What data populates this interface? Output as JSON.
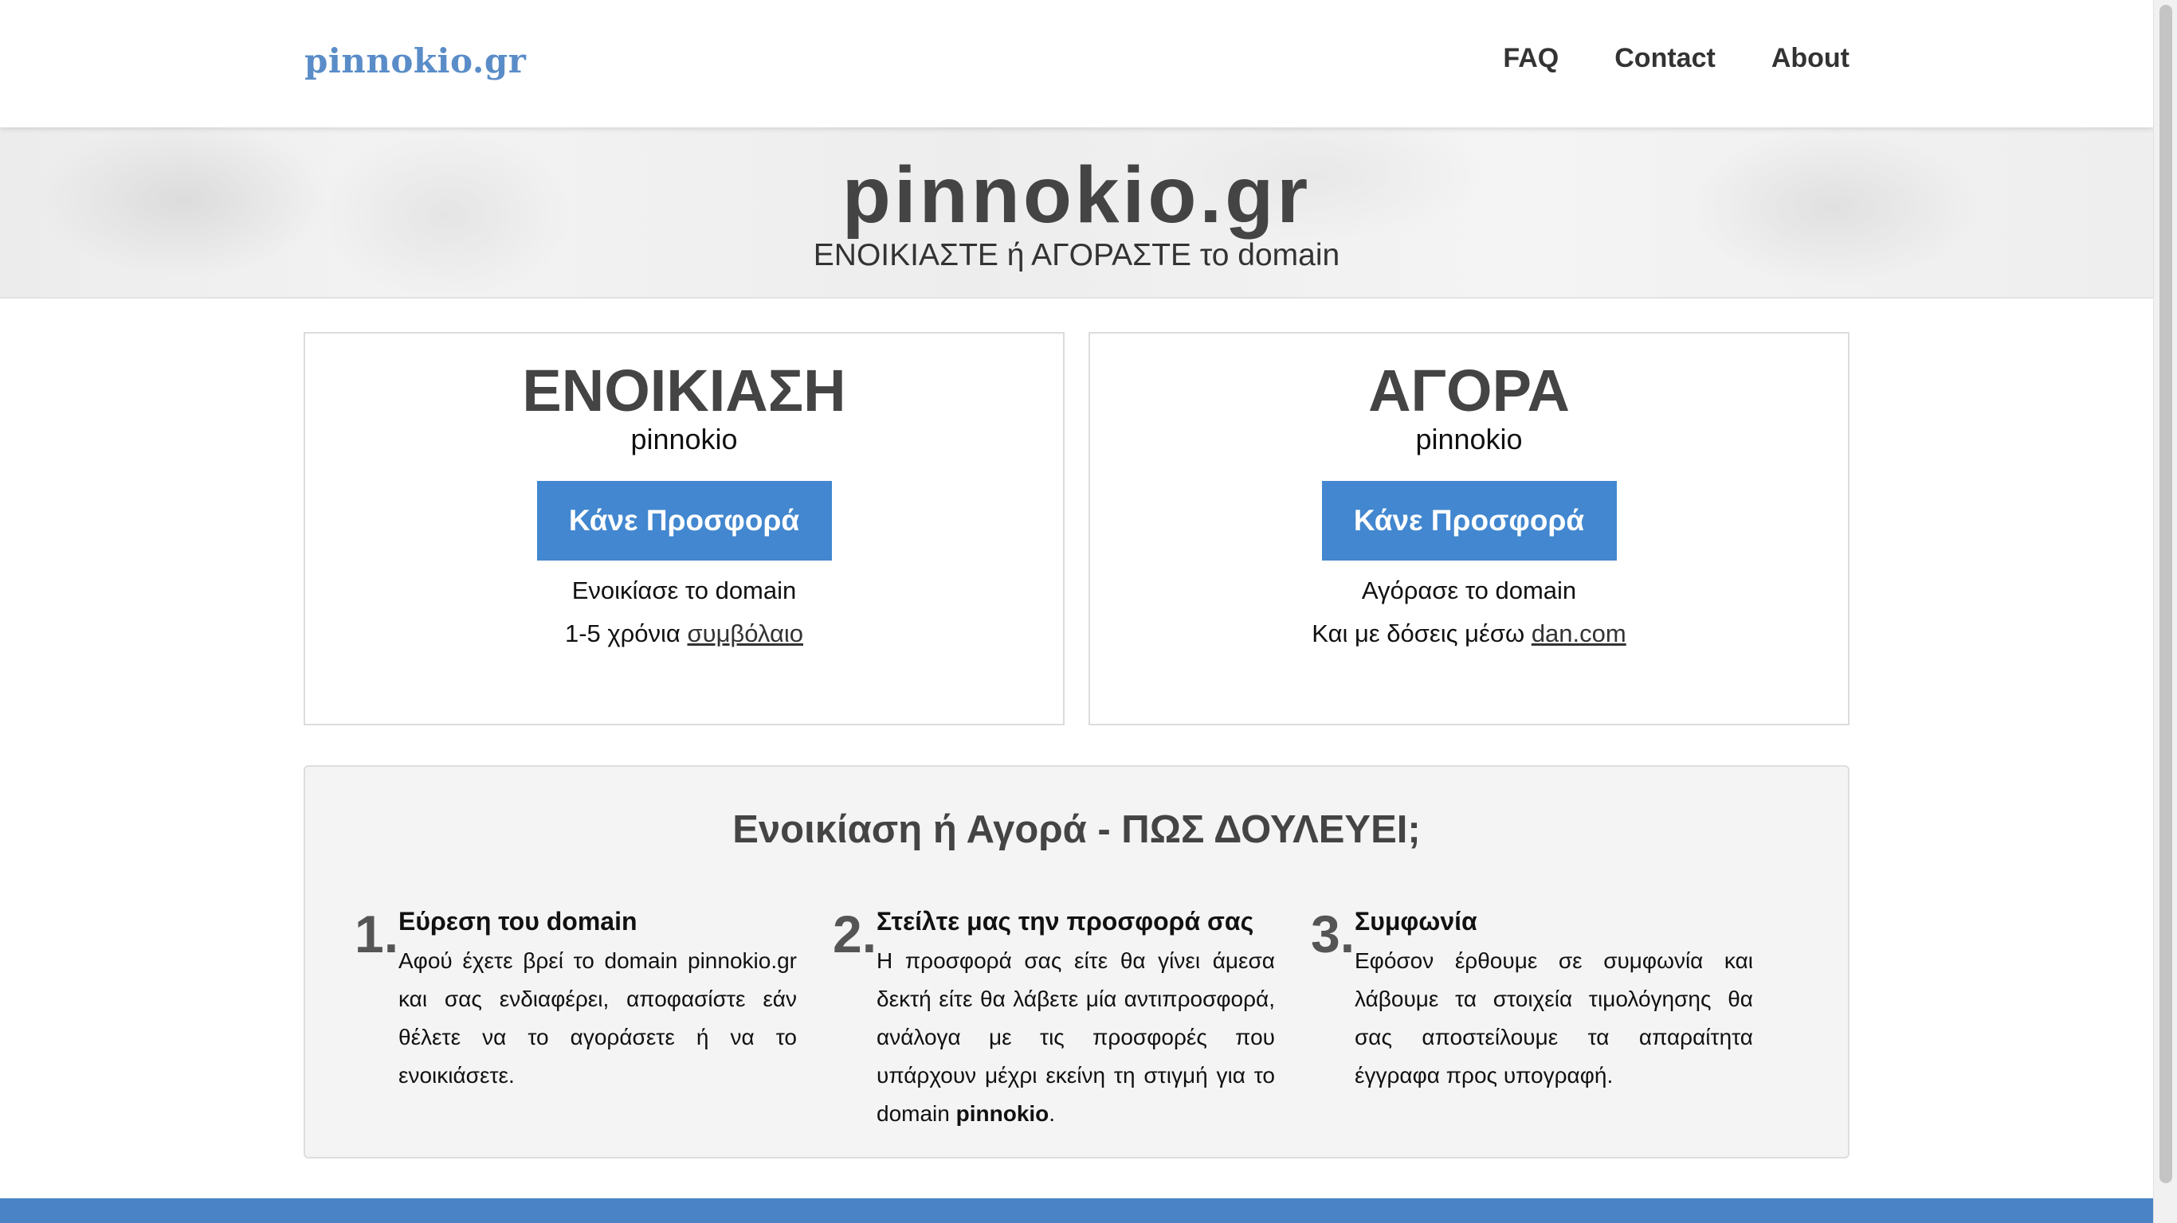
{
  "header": {
    "brand": "pinnokio.gr",
    "nav": [
      {
        "label": "FAQ"
      },
      {
        "label": "Contact"
      },
      {
        "label": "About"
      }
    ]
  },
  "hero": {
    "title": "pinnokio.gr",
    "subtitle": "ΕΝΟΙΚΙΑΣΤΕ ή ΑΓΟΡΑΣΤΕ το domain"
  },
  "rent": {
    "title": "ΕΝΟΙΚΙΑΣΗ",
    "domain": "pinnokio",
    "button_label": "Κάνε Προσφορά",
    "line1": "Ενοικίασε το domain",
    "line2_prefix": "1-5 χρόνια",
    "line2_link": "συμβόλαιο"
  },
  "buy": {
    "title": "ΑΓΟΡΑ",
    "domain": "pinnokio",
    "button_label": "Κάνε Προσφορά",
    "line1": "Αγόρασε το domain",
    "line2_prefix": "Και με δόσεις μέσω",
    "line2_link": "dan.com"
  },
  "how": {
    "title": "Ενοικίαση ή Αγορά - ΠΩΣ ΔΟΥΛΕΥΕΙ;",
    "steps": [
      {
        "number": "1.",
        "heading": "Εύρεση του domain",
        "text": "Αφού έχετε βρεί το domain pinnokio.gr και σας ενδιαφέρει, αποφασίστε εάν θέλετε να το αγοράσετε ή να το ενοικιάσετε."
      },
      {
        "number": "2.",
        "heading": "Στείλτε μας την προσφορά σας",
        "text": "Η προσφορά σας είτε θα γίνει άμεσα δεκτή είτε θα λάβετε μία αντιπροσφορά, ανάλογα με τις προσφορές που υπάρχουν μέχρι εκείνη τη στιγμή για το domain",
        "text_bold": "pinnokio",
        "text_end": "."
      },
      {
        "number": "3.",
        "heading": "Συμφωνία",
        "text": "Εφόσον έρθουμε σε συμφωνία και λάβουμε τα στοιχεία τιμολόγησης θα σας αποστείλουμε τα απαραίτητα έγγραφα προς υπογραφή."
      }
    ]
  },
  "colors": {
    "brand": "#5a8dc8",
    "button": "#4287cf",
    "footer": "#4a84c6"
  }
}
